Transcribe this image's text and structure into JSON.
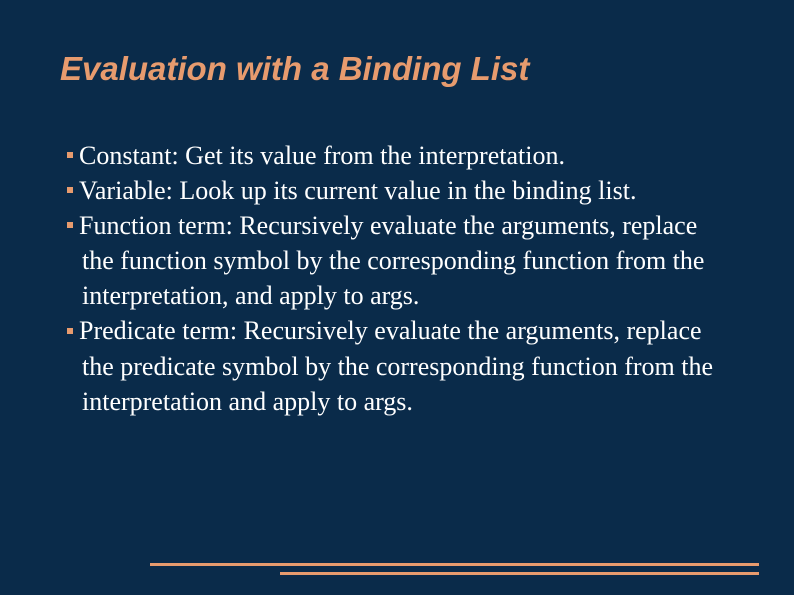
{
  "title": "Evaluation with a Binding List",
  "bullets": [
    "Constant: Get its value from the interpretation.",
    "Variable: Look up its current value in the binding list.",
    "Function term: Recursively evaluate the arguments, replace the function symbol by the corresponding function from the interpretation, and apply to args.",
    "Predicate term: Recursively evaluate the arguments, replace the predicate symbol by the corresponding function from the interpretation and apply to args."
  ]
}
